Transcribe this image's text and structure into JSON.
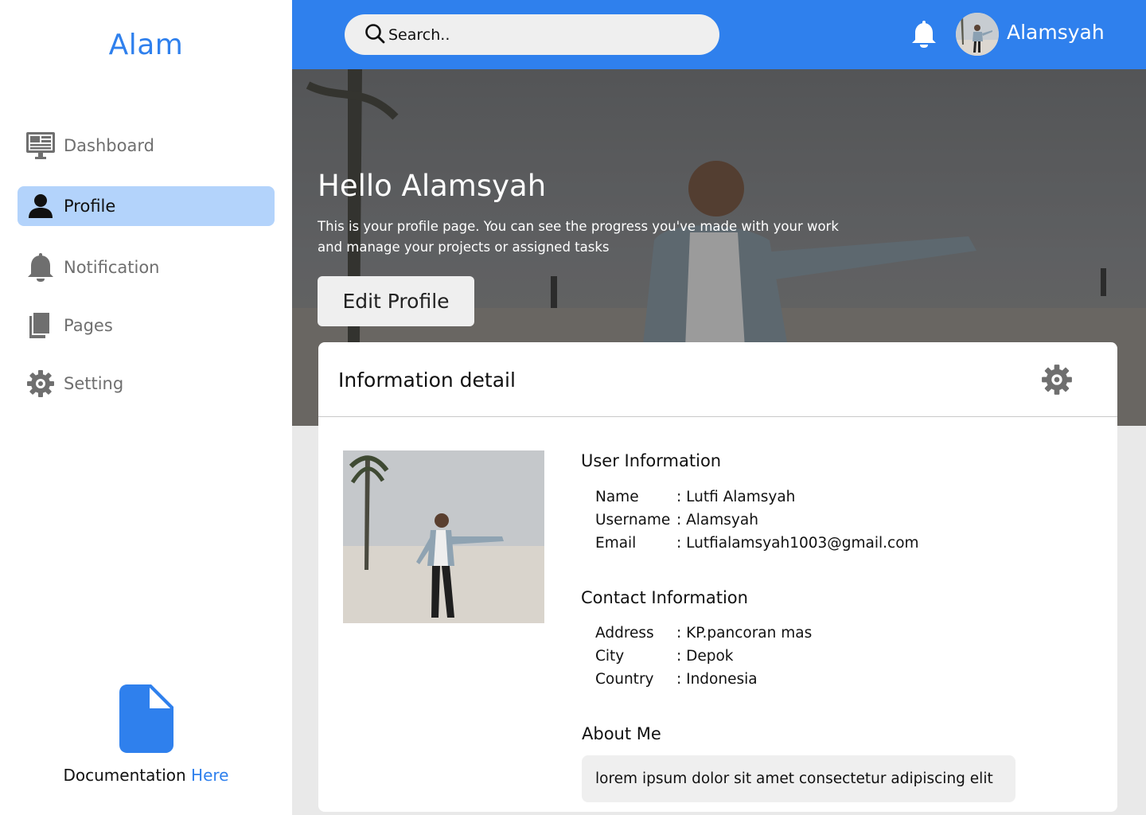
{
  "app": {
    "brand": "Alam"
  },
  "sidebar": {
    "items": [
      {
        "label": "Dashboard",
        "icon": "dashboard-icon",
        "active": false
      },
      {
        "label": "Profile",
        "icon": "user-icon",
        "active": true
      },
      {
        "label": "Notification",
        "icon": "bell-icon",
        "active": false
      },
      {
        "label": "Pages",
        "icon": "pages-icon",
        "active": false
      },
      {
        "label": "Setting",
        "icon": "gear-icon",
        "active": false
      }
    ],
    "docs": {
      "text": "Documentation",
      "link": "Here",
      "icon": "document-icon"
    }
  },
  "topbar": {
    "search_placeholder": "Search..",
    "username": "Alamsyah",
    "icons": [
      "search-icon",
      "bell-icon",
      "avatar"
    ]
  },
  "hero": {
    "title": "Hello Alamsyah",
    "subtitle": "This is your profile page. You can see the progress you've made with your work and manage your projects or assigned tasks",
    "edit_button": "Edit Profile"
  },
  "card": {
    "title": "Information detail",
    "user_info": {
      "title": "User Information",
      "rows": [
        {
          "key": "Name",
          "value": ": Lutfi Alamsyah"
        },
        {
          "key": "Username",
          "value": ": Alamsyah"
        },
        {
          "key": "Email",
          "value": ": Lutfialamsyah1003@gmail.com"
        }
      ]
    },
    "contact_info": {
      "title": "Contact Information",
      "rows": [
        {
          "key": "Address",
          "value": ": KP.pancoran mas"
        },
        {
          "key": "City",
          "value": ": Depok"
        },
        {
          "key": "Country",
          "value": ": Indonesia"
        }
      ]
    },
    "about": {
      "title": "About Me",
      "text": "lorem ipsum dolor sit amet consectetur adipiscing elit"
    }
  },
  "colors": {
    "accent": "#2f80ed",
    "active_nav": "#b3d3fb",
    "page_bg": "#e9e9e9"
  }
}
